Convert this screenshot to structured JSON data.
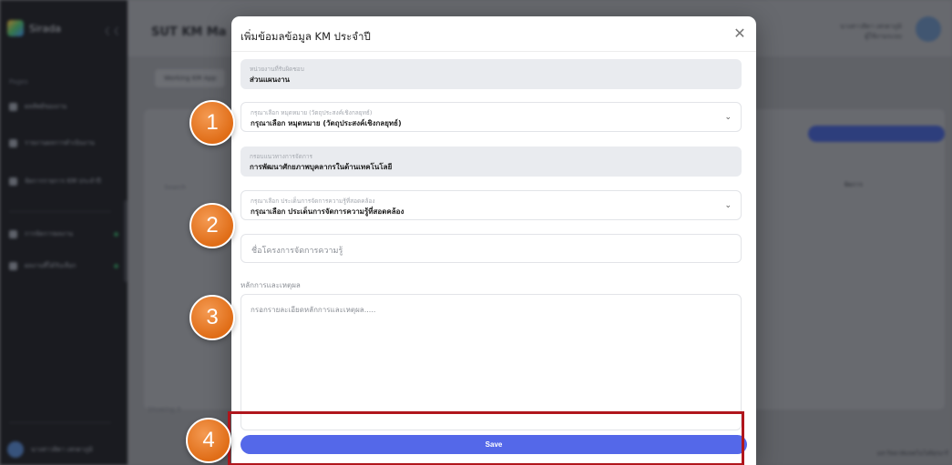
{
  "background": {
    "sidebar": {
      "brand": "Sirada",
      "collapse_icon": "collapse-icon",
      "section": "Pages",
      "items": [
        {
          "label": "ผลลัพธ์ของงาน"
        },
        {
          "label": "รายงานผลการดำเนินงาน"
        },
        {
          "label": "จัดการรายการ KM ประจำปี"
        },
        {
          "label": "การจัดการผลงาน"
        },
        {
          "label": "ผลงานที่ได้รับเลือก"
        }
      ],
      "user": "นางสาวสิตา เสกตาภูมิ"
    },
    "topbar": {
      "title": "SUT KM Ma",
      "user_name": "นางสาวสิตา เสกตาภูมิ",
      "user_role": "ผู้ใช้งานระบบ"
    },
    "content": {
      "tab": "Working KM App",
      "add_button": "+ เพิ่มข้อมูล KM ประจำปี",
      "column": "จัดการ",
      "search": "Search",
      "footer": "Showing 0",
      "footnote": "มหาวิทยาลัยเทคโนโลยีสุรนารี"
    }
  },
  "modal": {
    "title": "เพิ่มข้อมลข้อมูล KM ประจำปี",
    "close_icon": "close-icon",
    "fields": {
      "department": {
        "label": "หน่วยงานที่รับผิดชอบ",
        "value": "ส่วนแผนงาน"
      },
      "goal": {
        "label": "กรุณาเลือก หมุดหมาย (วัตถุประสงค์เชิงกลยุทธ์)",
        "value": "กรุณาเลือก หมุดหมาย (วัตถุประสงค์เชิงกลยุทธ์)"
      },
      "framework": {
        "label": "กรอบแนวทางการจัดการ",
        "value": "การพัฒนาศักยภาพบุคลากรในด้านเทคโนโลยี"
      },
      "km_issue": {
        "label": "กรุณาเลือก ประเด็นการจัดการความรู้ที่สอดคล้อง",
        "value": "กรุณาเลือก ประเด็นการจัดการความรู้ที่สอดคล้อง"
      },
      "project_name": {
        "placeholder": "ชื่อโครงการจัดการความรู้"
      },
      "rationale": {
        "label": "หลักการและเหตุผล",
        "placeholder": "กรอกรายละเอียดหลักการและเหตุผล....."
      }
    },
    "save_label": "Save"
  },
  "annotations": {
    "steps": [
      "1",
      "2",
      "3",
      "4"
    ],
    "marker_color": "#E8771F",
    "highlight_color": "#B0161C"
  }
}
